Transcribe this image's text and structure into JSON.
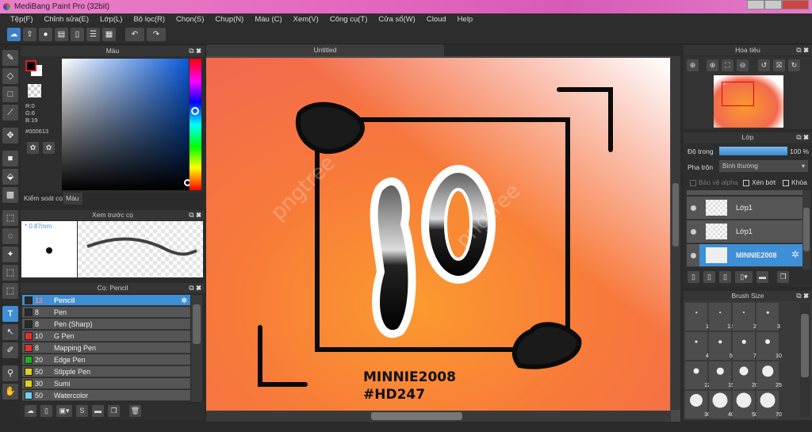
{
  "app": {
    "title": "MediBang Paint Pro (32bit)"
  },
  "menu": [
    "Tệp(F)",
    "Chỉnh sửa(E)",
    "Lớp(L)",
    "Bộ lọc(R)",
    "Chọn(S)",
    "Chụp(N)",
    "Màu (C)",
    "Xem(V)",
    "Công cụ(T)",
    "Cửa sổ(W)",
    "Cloud",
    "Help"
  ],
  "color_panel": {
    "title": "Màu",
    "r": "R:0",
    "g": "G:6",
    "b": "B:19",
    "hex": "#000613",
    "tab_brush_control": "Kiểm soát cọ",
    "tab_color": "Màu",
    "primary": "#000613",
    "secondary": "#ffffff"
  },
  "preview_panel": {
    "title": "Xem trước cọ",
    "size": "* 0.87mm"
  },
  "brush_panel": {
    "title": "Cọ: Pencil",
    "items": [
      {
        "size": "12",
        "name": "Pencil",
        "color": "#2a2a2a"
      },
      {
        "size": "8",
        "name": "Pen",
        "color": "#2a2a2a"
      },
      {
        "size": "8",
        "name": "Pen (Sharp)",
        "color": "#2a2a2a"
      },
      {
        "size": "10",
        "name": "G Pen",
        "color": "#e83030"
      },
      {
        "size": "8",
        "name": "Mapping Pen",
        "color": "#e83030"
      },
      {
        "size": "20",
        "name": "Edge Pen",
        "color": "#20b020"
      },
      {
        "size": "50",
        "name": "Stipple Pen",
        "color": "#e0d020"
      },
      {
        "size": "30",
        "name": "Sumi",
        "color": "#e0d020"
      },
      {
        "size": "50",
        "name": "Watercolor",
        "color": "#70d0f0"
      }
    ]
  },
  "canvas": {
    "title": "Untitled",
    "text_line1": "MINNIE2008",
    "text_line2": "#HD247",
    "art_number": "10",
    "watermark": "pngtree"
  },
  "navigator": {
    "title": "Hoa tiêu"
  },
  "layer_panel": {
    "title": "Lớp",
    "opacity_label": "Độ trong",
    "opacity_value": "100 %",
    "opacity": 100,
    "blend_label": "Pha trộn",
    "blend_value": "Bình thường",
    "protect_alpha": "Bảo vệ alpha",
    "clipping": "Xén bớt",
    "lock": "Khóa",
    "layers": [
      {
        "name": "Lớp1"
      },
      {
        "name": "Lớp1"
      },
      {
        "name": "MINNIE2008"
      }
    ]
  },
  "brush_size_panel": {
    "title": "Brush Size",
    "sizes": [
      "1",
      "1.5",
      "2",
      "3",
      "4",
      "5",
      "7",
      "10",
      "12",
      "15",
      "20",
      "25",
      "30",
      "40",
      "50",
      "70"
    ]
  }
}
